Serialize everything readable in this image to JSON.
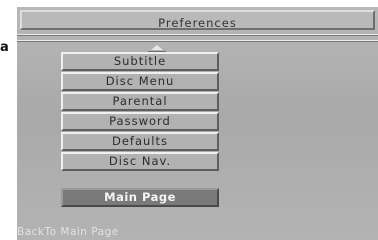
{
  "page_marker": "a",
  "window": {
    "title": "Preferences"
  },
  "menu": {
    "items": [
      {
        "label": "Subtitle"
      },
      {
        "label": "Disc Menu"
      },
      {
        "label": "Parental"
      },
      {
        "label": "Password"
      },
      {
        "label": "Defaults"
      },
      {
        "label": "Disc Nav."
      }
    ],
    "scroll_indicator_icon": "up-arrow-icon"
  },
  "main_page_button": {
    "label": "Main Page"
  },
  "hint": {
    "text": "BackTo Main Page"
  },
  "colors": {
    "background": "#ababab",
    "button_face": "#b2b2b2",
    "selected_button": "#7a7a7a",
    "selected_text": "#f4f4f4",
    "hint_text": "#e2e2e2"
  }
}
